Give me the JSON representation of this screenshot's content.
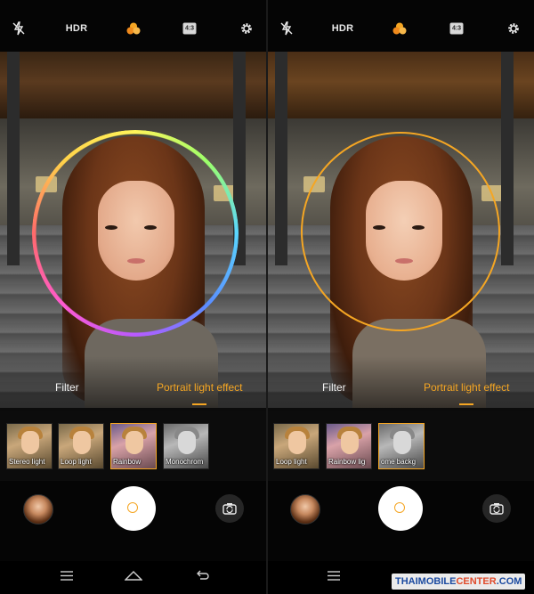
{
  "colors": {
    "accent": "#f5a623",
    "background": "#000000",
    "text": "#f2f2f2"
  },
  "panels": [
    {
      "topbar": {
        "flash_icon": "flash-off-icon",
        "hdr_label": "HDR",
        "beauty_icon": "beauty-filter-icon",
        "ratio_label": "4:3",
        "settings_icon": "gear-icon"
      },
      "light_effect_ring": "rainbow",
      "tabs": {
        "filter": "Filter",
        "portrait": "Portrait light effect",
        "active": "portrait"
      },
      "effects": [
        {
          "label": "Stereo light",
          "selected": false
        },
        {
          "label": "Loop light",
          "selected": false
        },
        {
          "label": "Rainbow",
          "selected": true
        },
        {
          "label": "Monochrom",
          "selected": false
        }
      ],
      "controls": {
        "gallery_icon": "gallery-thumbnail",
        "shutter_icon": "shutter-icon",
        "switch_icon": "camera-switch-icon"
      },
      "navbar": {
        "menu_icon": "menu-icon",
        "home_icon": "home-icon",
        "back_icon": "back-icon"
      }
    },
    {
      "topbar": {
        "flash_icon": "flash-off-icon",
        "hdr_label": "HDR",
        "beauty_icon": "beauty-filter-icon",
        "ratio_label": "4:3",
        "settings_icon": "gear-icon"
      },
      "light_effect_ring": "gold",
      "tabs": {
        "filter": "Filter",
        "portrait": "Portrait light effect",
        "active": "portrait"
      },
      "effects": [
        {
          "label": "Loop light",
          "selected": false
        },
        {
          "label": "Rainbow lig",
          "selected": false
        },
        {
          "label": "ome backg",
          "selected": true
        }
      ],
      "controls": {
        "gallery_icon": "gallery-thumbnail",
        "shutter_icon": "shutter-icon",
        "switch_icon": "camera-switch-icon"
      },
      "navbar": {
        "menu_icon": "menu-icon",
        "home_icon": "home-icon",
        "back_icon": "back-icon"
      }
    }
  ],
  "watermark": {
    "part1": "THAIMOBILE",
    "part2": "CENTER",
    "part3": ".COM"
  }
}
